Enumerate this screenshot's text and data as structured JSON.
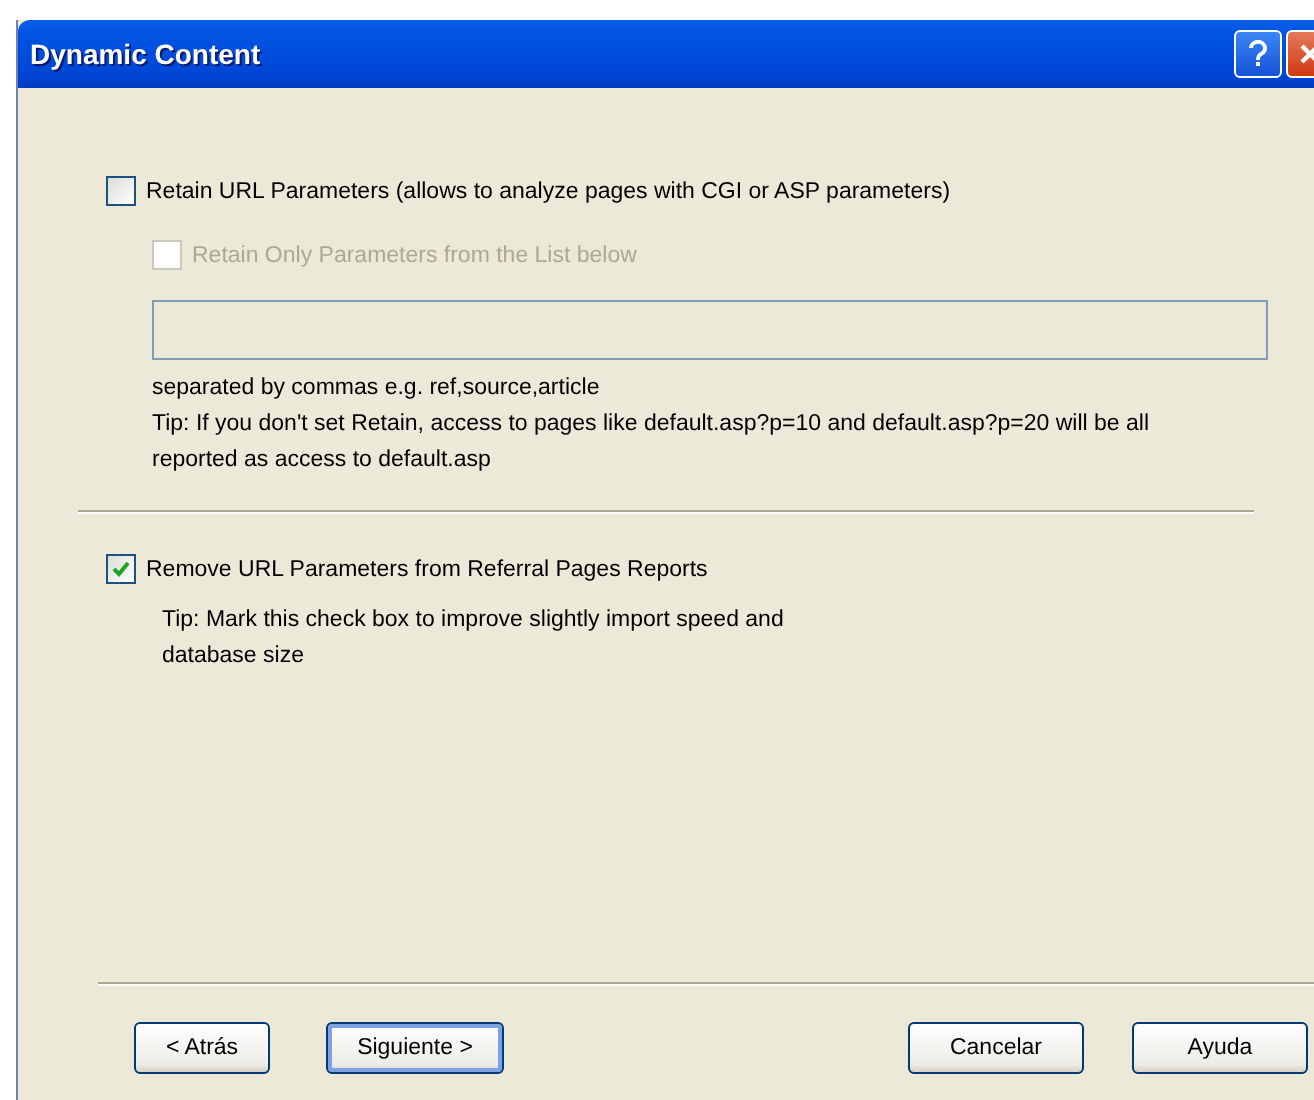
{
  "window": {
    "title": "Dynamic Content"
  },
  "retain": {
    "label": "Retain URL Parameters (allows to analyze pages with CGI or ASP parameters)",
    "checked": false
  },
  "retain_only": {
    "label": "Retain Only Parameters from the List below",
    "checked": false,
    "disabled": true
  },
  "hint": "separated by commas e.g. ref,source,article",
  "retain_tip": "Tip: If you don't set Retain, access to pages like default.asp?p=10 and default.asp?p=20 will be all reported as access to default.asp",
  "remove": {
    "label": "Remove URL Parameters from Referral Pages Reports",
    "checked": true
  },
  "remove_tip": "Tip: Mark this check box to improve slightly import speed and database size",
  "buttons": [
    {
      "label": "< Atrás",
      "default": false
    },
    {
      "label": "Siguiente >",
      "default": true
    },
    {
      "label": "Cancelar",
      "default": false
    },
    {
      "label": "Ayuda",
      "default": false
    }
  ]
}
